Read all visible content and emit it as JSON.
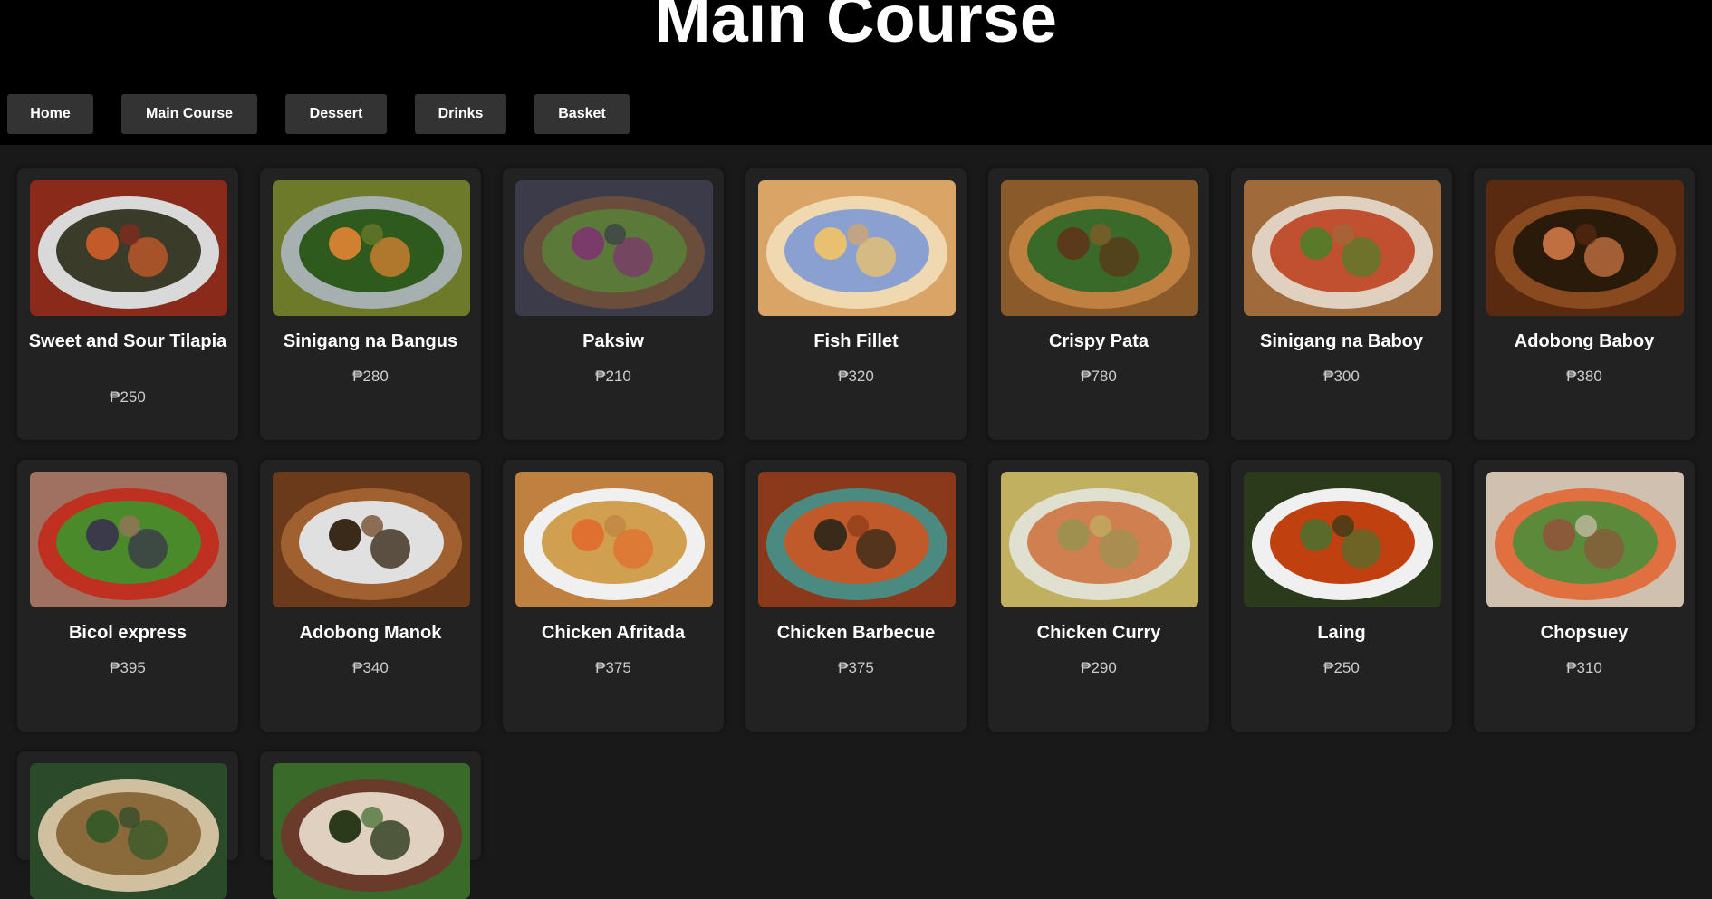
{
  "page": {
    "title": "Main Course"
  },
  "nav": [
    "Home",
    "Main Course",
    "Dessert",
    "Drinks",
    "Basket"
  ],
  "items": [
    {
      "name": "Sweet and Sour Tilapia",
      "price": "₱250",
      "colors": [
        "#8a2a1a",
        "#d9d9d9",
        "#3b3b2a",
        "#c25a2a"
      ]
    },
    {
      "name": "Sinigang na Bangus",
      "price": "₱280",
      "colors": [
        "#6d7a2a",
        "#a7b0b0",
        "#2e5a1e",
        "#d08030"
      ]
    },
    {
      "name": "Paksiw",
      "price": "₱210",
      "colors": [
        "#3b3b4a",
        "#6a4d3a",
        "#5b7a3a",
        "#7a3a6a"
      ]
    },
    {
      "name": "Fish Fillet",
      "price": "₱320",
      "colors": [
        "#d9a466",
        "#f0d9b0",
        "#8aa0d0",
        "#e8c070"
      ]
    },
    {
      "name": "Crispy Pata",
      "price": "₱780",
      "colors": [
        "#8a5a2a",
        "#c08040",
        "#3a6a2a",
        "#5a3a1a"
      ]
    },
    {
      "name": "Sinigang na Baboy",
      "price": "₱300",
      "colors": [
        "#a06a3a",
        "#e0d0c0",
        "#c05030",
        "#5a7a2a"
      ]
    },
    {
      "name": "Adobong Baboy",
      "price": "₱380",
      "colors": [
        "#5a2a10",
        "#8a4a20",
        "#2a1a0a",
        "#c07040"
      ]
    },
    {
      "name": "Bicol express",
      "price": "₱395",
      "colors": [
        "#a07060",
        "#c03020",
        "#4a8a2a",
        "#3a3a4a"
      ]
    },
    {
      "name": "Adobong Manok",
      "price": "₱340",
      "colors": [
        "#6a3a1a",
        "#a06030",
        "#e0e0e0",
        "#3a2a1a"
      ]
    },
    {
      "name": "Chicken Afritada",
      "price": "₱375",
      "colors": [
        "#c08040",
        "#f0f0f0",
        "#d0a050",
        "#e07030"
      ]
    },
    {
      "name": "Chicken Barbecue",
      "price": "₱375",
      "colors": [
        "#8a3a1a",
        "#4a8a80",
        "#c05a2a",
        "#3a2a1a"
      ]
    },
    {
      "name": "Chicken Curry",
      "price": "₱290",
      "colors": [
        "#c0b060",
        "#e0e0d0",
        "#d08050",
        "#a09050"
      ]
    },
    {
      "name": "Laing",
      "price": "₱250",
      "colors": [
        "#2a3a1a",
        "#f0f0f0",
        "#c04010",
        "#5a6a2a"
      ]
    },
    {
      "name": "Chopsuey",
      "price": "₱310",
      "colors": [
        "#d0c0b0",
        "#e07040",
        "#5a8a3a",
        "#8a5a3a"
      ]
    },
    {
      "name": "",
      "price": "",
      "colors": [
        "#2a4a2a",
        "#d0c0a0",
        "#8a6a3a",
        "#3a5a2a"
      ]
    },
    {
      "name": "",
      "price": "",
      "colors": [
        "#3a6a2a",
        "#6a3a2a",
        "#e0d0c0",
        "#2a3a1a"
      ]
    }
  ]
}
